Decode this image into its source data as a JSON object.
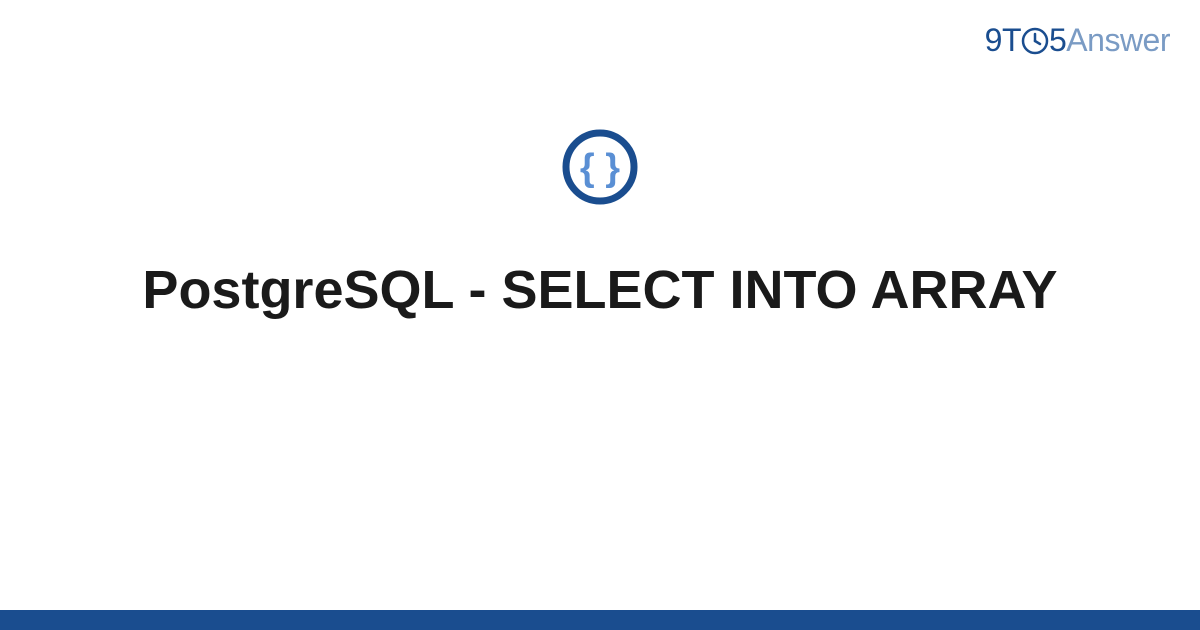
{
  "brand": {
    "part1": "9T",
    "part2": "5",
    "part3": "Answer"
  },
  "icon": {
    "name": "code-braces-icon"
  },
  "title": "PostgreSQL - SELECT INTO ARRAY",
  "colors": {
    "primary": "#1a4d8f",
    "secondary": "#7a9bc4",
    "iconRing": "#1a4d8f",
    "iconGlyph": "#5a8fd4"
  }
}
